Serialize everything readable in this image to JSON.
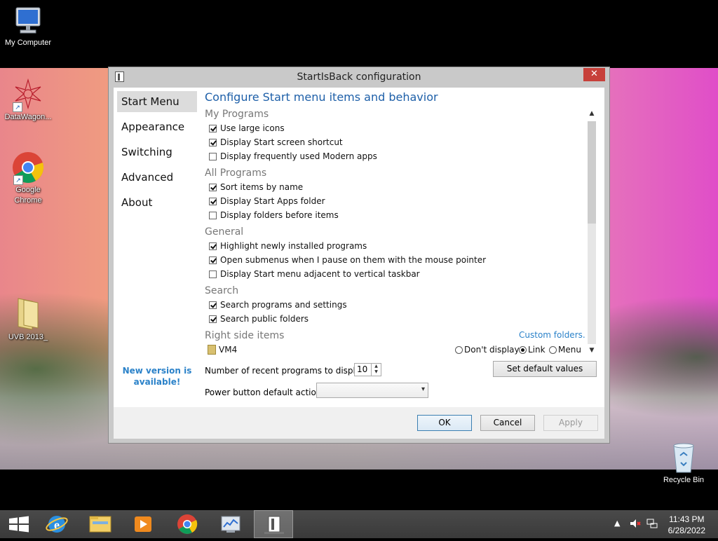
{
  "desktop": {
    "icons": [
      {
        "label": "My Computer"
      },
      {
        "label": "DataWagon..."
      },
      {
        "label": "Google Chrome"
      },
      {
        "label": "UVB 2013_"
      },
      {
        "label": "Recycle Bin"
      }
    ]
  },
  "dialog": {
    "title": "StartIsBack configuration",
    "close_label": "✕",
    "nav": [
      {
        "label": "Start Menu",
        "active": true
      },
      {
        "label": "Appearance"
      },
      {
        "label": "Switching"
      },
      {
        "label": "Advanced"
      },
      {
        "label": "About"
      }
    ],
    "new_version": "New version is available!",
    "heading": "Configure Start menu items and behavior",
    "sections": {
      "my_programs": {
        "title": "My Programs",
        "options": [
          {
            "label": "Use large icons",
            "checked": true
          },
          {
            "label": "Display Start screen shortcut",
            "checked": true
          },
          {
            "label": "Display frequently used Modern apps",
            "checked": false
          }
        ]
      },
      "all_programs": {
        "title": "All Programs",
        "options": [
          {
            "label": "Sort items by name",
            "checked": true
          },
          {
            "label": "Display Start Apps folder",
            "checked": true
          },
          {
            "label": "Display folders before items",
            "checked": false
          }
        ]
      },
      "general": {
        "title": "General",
        "options": [
          {
            "label": "Highlight newly installed programs",
            "checked": true
          },
          {
            "label": "Open submenus when I pause on them with the mouse pointer",
            "checked": true
          },
          {
            "label": "Display Start menu adjacent to vertical taskbar",
            "checked": false
          }
        ]
      },
      "search": {
        "title": "Search",
        "options": [
          {
            "label": "Search programs and settings",
            "checked": true
          },
          {
            "label": "Search public folders",
            "checked": true
          }
        ]
      },
      "right_side": {
        "title": "Right side items",
        "custom_folders": "Custom folders...",
        "item_label": "VM4",
        "radio": [
          {
            "label": "Don't display",
            "selected": false
          },
          {
            "label": "Link",
            "selected": true
          },
          {
            "label": "Menu",
            "selected": false
          }
        ]
      }
    },
    "recent_label": "Number of recent programs to display:",
    "recent_value": "10",
    "set_default_label": "Set default values",
    "power_label": "Power button default action:",
    "power_value": "",
    "ok_label": "OK",
    "cancel_label": "Cancel",
    "apply_label": "Apply"
  },
  "taskbar": {
    "time": "11:43 PM",
    "date": "6/28/2022"
  }
}
